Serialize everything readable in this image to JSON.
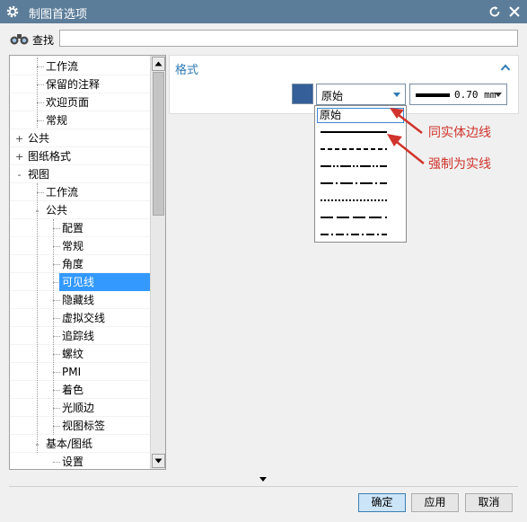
{
  "window": {
    "title": "制图首选项"
  },
  "search": {
    "label": "查找",
    "value": ""
  },
  "tree": {
    "items": [
      {
        "label": "工作流",
        "level": 1
      },
      {
        "label": "保留的注释",
        "level": 1
      },
      {
        "label": "欢迎页面",
        "level": 1
      },
      {
        "label": "常规",
        "level": 1
      },
      {
        "label": "公共",
        "level": 0,
        "expander": "+"
      },
      {
        "label": "图纸格式",
        "level": 0,
        "expander": "+"
      },
      {
        "label": "视图",
        "level": 0,
        "expander": "-"
      },
      {
        "label": "工作流",
        "level": 1
      },
      {
        "label": "公共",
        "level": 1,
        "expander": "-"
      },
      {
        "label": "配置",
        "level": 2
      },
      {
        "label": "常规",
        "level": 2
      },
      {
        "label": "角度",
        "level": 2
      },
      {
        "label": "可见线",
        "level": 2,
        "selected": true
      },
      {
        "label": "隐藏线",
        "level": 2
      },
      {
        "label": "虚拟交线",
        "level": 2
      },
      {
        "label": "追踪线",
        "level": 2
      },
      {
        "label": "螺纹",
        "level": 2
      },
      {
        "label": "PMI",
        "level": 2
      },
      {
        "label": "着色",
        "level": 2
      },
      {
        "label": "光顺边",
        "level": 2
      },
      {
        "label": "视图标签",
        "level": 2
      },
      {
        "label": "基本/图纸",
        "level": 1,
        "expander": "-"
      },
      {
        "label": "设置",
        "level": 2
      }
    ]
  },
  "format_section": {
    "title": "格式",
    "color": "#345f99",
    "font_value": "原始",
    "width_value": "0.70 mm"
  },
  "font_dropdown": {
    "first_option": "原始",
    "line_styles": [
      "solid",
      "dashed",
      "long-dash-double-dot",
      "long-dash-dot",
      "dotted",
      "long-dash",
      "dash-dot"
    ]
  },
  "annotations": {
    "first": "同实体边线",
    "second": "强制为实线",
    "color": "#d0342c"
  },
  "buttons": {
    "ok": "确定",
    "apply": "应用",
    "cancel": "取消"
  }
}
